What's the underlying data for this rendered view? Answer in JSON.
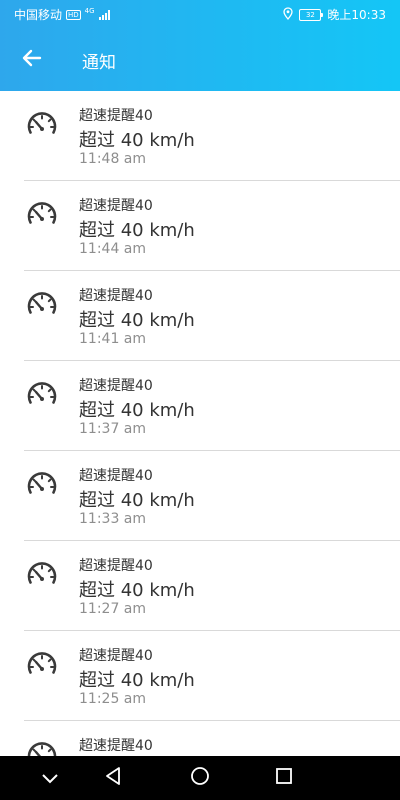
{
  "status_bar": {
    "carrier": "中国移动",
    "hd_badge": "HD",
    "network": "4G",
    "battery": "32",
    "time": "晚上10:33"
  },
  "app_bar": {
    "title": "通知"
  },
  "notifications": [
    {
      "title": "超速提醒40",
      "message": "超过 40 km/h",
      "time": "11:48 am"
    },
    {
      "title": "超速提醒40",
      "message": "超过 40 km/h",
      "time": "11:44 am"
    },
    {
      "title": "超速提醒40",
      "message": "超过 40 km/h",
      "time": "11:41 am"
    },
    {
      "title": "超速提醒40",
      "message": "超过 40 km/h",
      "time": "11:37 am"
    },
    {
      "title": "超速提醒40",
      "message": "超过 40 km/h",
      "time": "11:33 am"
    },
    {
      "title": "超速提醒40",
      "message": "超过 40 km/h",
      "time": "11:27 am"
    },
    {
      "title": "超速提醒40",
      "message": "超过 40 km/h",
      "time": "11:25 am"
    },
    {
      "title": "超速提醒40",
      "message": "",
      "time": ""
    }
  ],
  "icons": {
    "back": "arrow-left-icon",
    "notification": "speedometer-icon",
    "nav": [
      "chevron-down-icon",
      "triangle-back-icon",
      "circle-home-icon",
      "square-recents-icon"
    ]
  },
  "colors": {
    "header_start": "#2ea7ec",
    "header_end": "#14c6f6",
    "divider": "#d9d9d9",
    "time_text": "#8e8e8e"
  }
}
